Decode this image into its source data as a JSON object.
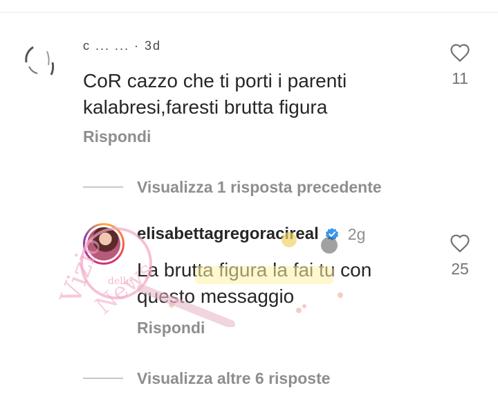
{
  "comments": [
    {
      "username": "c ... ... · 3d",
      "text": "CoR cazzo che ti porti i parenti kalabresi,faresti brutta figura",
      "reply_label": "Rispondi",
      "likes": "11",
      "icon": "heart-outline-icon"
    }
  ],
  "view_previous": "Visualizza 1 risposta precedente",
  "reply": {
    "username": "elisabettagregoracireal",
    "verified_icon": "verified-badge-icon",
    "time": "2g",
    "text": "La brutta figura la fai tu con questo messaggio",
    "reply_label": "Rispondi",
    "likes": "25"
  },
  "view_more": "Visualizza altre 6 risposte",
  "watermark": {
    "text_main": "Vizio",
    "text_mid": "delle",
    "text_end": "News"
  },
  "colors": {
    "text": "#262626",
    "secondary": "#8e8e8e",
    "verified": "#3897f0",
    "watermark": "#f2a7c6"
  }
}
